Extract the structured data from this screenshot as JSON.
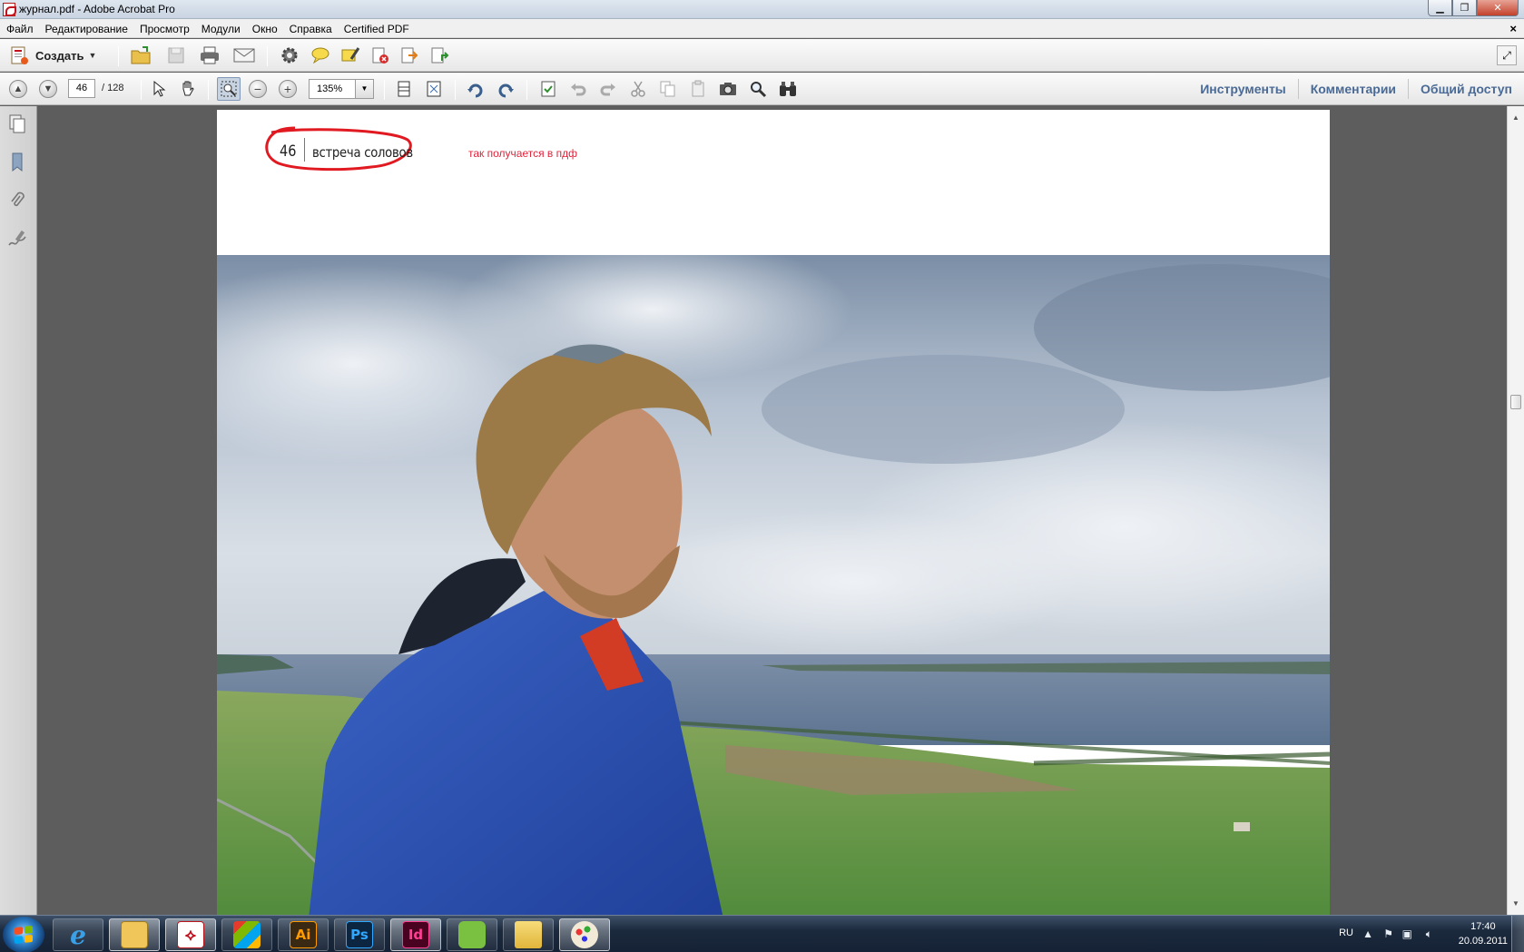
{
  "window": {
    "title": "журнал.pdf - Adobe Acrobat Pro",
    "doc_close_glyph": "×"
  },
  "menu": {
    "items": [
      "Файл",
      "Редактирование",
      "Просмотр",
      "Модули",
      "Окно",
      "Справка",
      "Certified PDF"
    ]
  },
  "toolbar1": {
    "create_label": "Создать",
    "buttons": [
      "open-icon",
      "save-icon",
      "print-icon",
      "email-icon",
      "gear-icon",
      "comment-icon",
      "highlight-icon",
      "delete-pdf-icon",
      "export-pdf-icon",
      "share-icon"
    ]
  },
  "toolbar2": {
    "current_page": "46",
    "total_pages": "/ 128",
    "zoom": "135%",
    "right_tabs": [
      "Инструменты",
      "Комментарии",
      "Общий доступ"
    ]
  },
  "document": {
    "page_number": "46",
    "section_title": "встреча соловов",
    "annotation": "так получается в пдф",
    "annotation_color": "#e0243a"
  },
  "taskbar": {
    "apps": [
      "internet-explorer",
      "outlook",
      "acrobat",
      "windows-media",
      "illustrator",
      "photoshop",
      "indesign",
      "evernote",
      "explorer",
      "paint"
    ],
    "app_labels": {
      "illustrator": "Ai",
      "photoshop": "Ps",
      "indesign": "Id"
    },
    "language": "RU",
    "time": "17:40",
    "date": "20.09.2011"
  }
}
